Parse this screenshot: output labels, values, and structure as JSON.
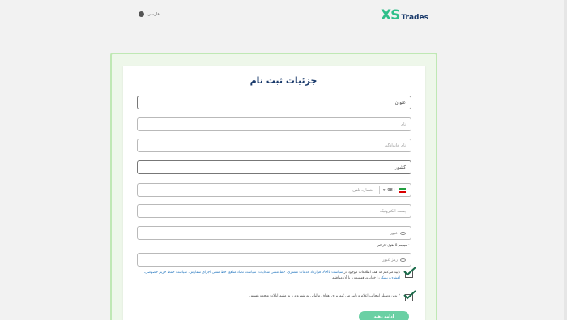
{
  "header": {
    "language_label": "فارسی",
    "logo_mark": "XS",
    "logo_word": "Trades"
  },
  "form": {
    "title": "جزئیات ثبت نام",
    "fields": {
      "salutation": "عنوان",
      "first_name": "نام",
      "last_name": "نام خانوادگی",
      "country": "کشور",
      "phone_placeholder": "شماره تلفن",
      "phone_code": "+98",
      "email": "پست الکترونیک",
      "password": "عبور",
      "confirm_password": "رمز عبور"
    },
    "password_hint": "• مینیمم 8 طول کاراکتر",
    "consent1": {
      "prefix": "تایید می‌کنم که همه اطلاعات موجود در",
      "link1": "سیاست AML، قرارداد خدمات مشتری، خط مشی شکایات، سیاست تضاد منافع، خط مشی اجرای سفارش،",
      "link2": "سیاست حفظ حریم خصوصی، افشای ریسک",
      "suffix": "را خوانده، فهمیده و با آن موافقم"
    },
    "consent2": "* بدین وسیله اینجانب اعلام و تایید می کنم برای اهداف مالیاتی نه شهروند و نه مقیم ایالات متحده هستم.",
    "submit_label": "ادامه دهید"
  },
  "colors": {
    "accent": "#2fbf8a",
    "brand_navy": "#1a3a6b",
    "frame_border": "#bfe8b4",
    "submit": "#6ad0a4"
  }
}
